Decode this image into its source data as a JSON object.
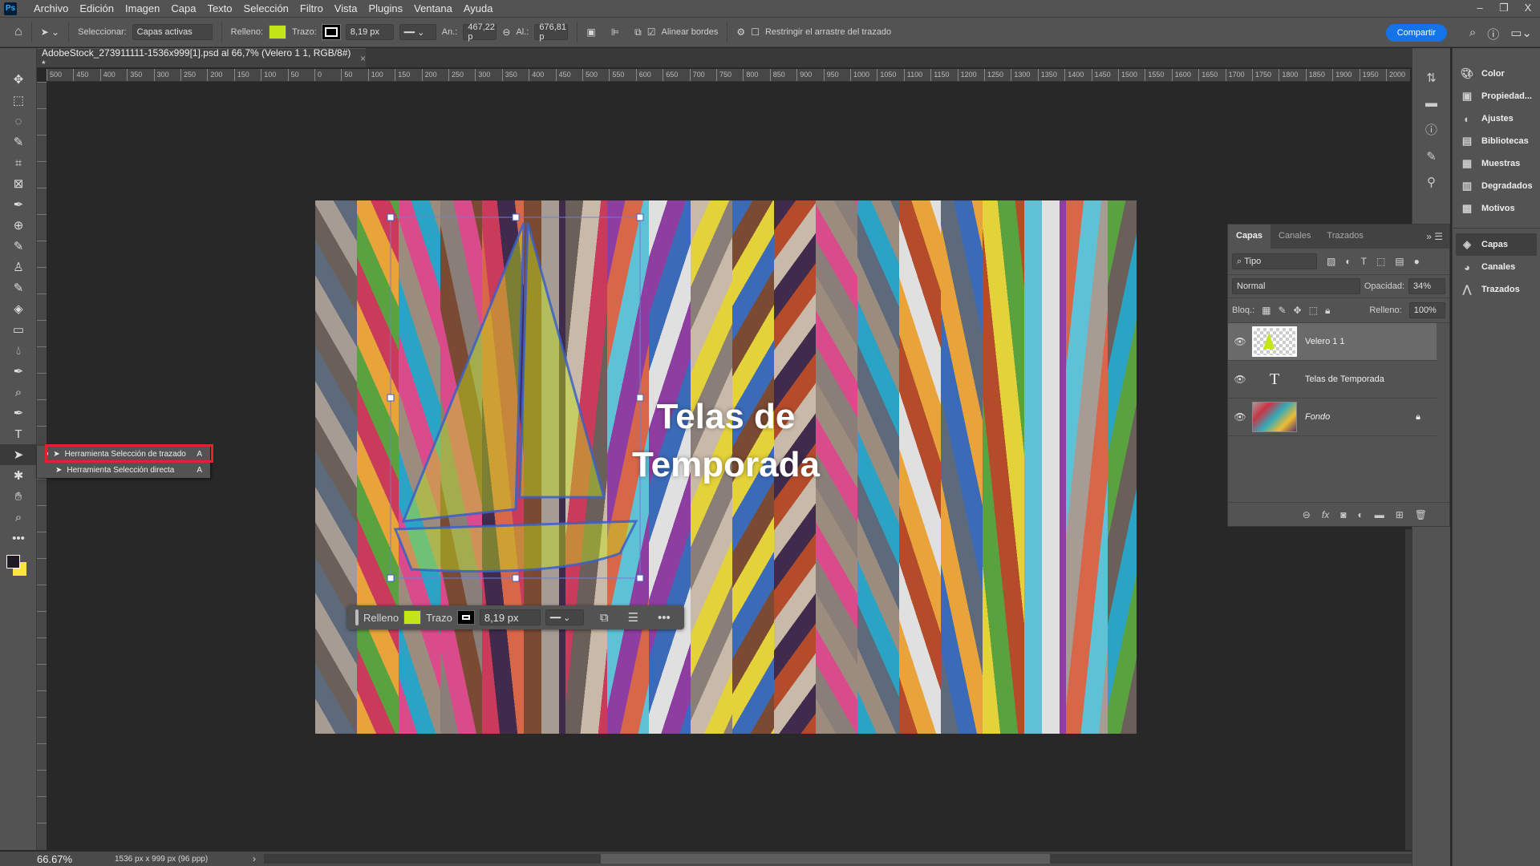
{
  "app": {
    "logo": "Ps"
  },
  "menu": [
    "Archivo",
    "Edición",
    "Imagen",
    "Capa",
    "Texto",
    "Selección",
    "Filtro",
    "Vista",
    "Plugins",
    "Ventana",
    "Ayuda"
  ],
  "window_controls": {
    "minimize": "–",
    "restore": "❐",
    "close": "X"
  },
  "options": {
    "select_label": "Seleccionar:",
    "select_value": "Capas activas",
    "fill_label": "Relleno:",
    "fill_color": "#c4e619",
    "stroke_label": "Trazo:",
    "stroke_width": "8,19 px",
    "width_label": "An.:",
    "width_value": "467,22 p",
    "height_label": "Al.:",
    "height_value": "676,81 p",
    "align_edges": "Alinear bordes",
    "restrict_drag": "Restringir el arrastre del trazado",
    "share": "Compartir"
  },
  "document": {
    "tab_title": "AdobeStock_273911111-1536x999[1].psd al 66,7% (Velero 1 1, RGB/8#) *",
    "canvas_title": [
      "Telas de",
      "Temporada"
    ]
  },
  "rulers": {
    "h": [
      500,
      450,
      400,
      350,
      300,
      250,
      200,
      150,
      100,
      50,
      0,
      50,
      100,
      150,
      200,
      250,
      300,
      350,
      400,
      450,
      500,
      550,
      600,
      650,
      700,
      750,
      800,
      850,
      900,
      950,
      1000,
      1050,
      1100,
      1150,
      1200,
      1250,
      1300,
      1350,
      1400,
      1450,
      1500,
      1550,
      1600,
      1650,
      1700,
      1750,
      1800,
      1850,
      1900,
      1950,
      2000
    ]
  },
  "flyout": {
    "items": [
      {
        "label": "Herramienta Selección de trazado",
        "key": "A",
        "selected": true
      },
      {
        "label": "Herramienta Selección directa",
        "key": "A"
      }
    ]
  },
  "context_bar": {
    "fill_label": "Relleno",
    "stroke_label": "Trazo",
    "stroke_width": "8,19 px"
  },
  "status": {
    "zoom": "66.67%",
    "doc_info": "1536 px x 999 px (96 ppp)"
  },
  "right_panels": [
    "Color",
    "Propiedad...",
    "Ajustes",
    "Bibliotecas",
    "Muestras",
    "Degradados",
    "Motivos"
  ],
  "right_panels2": [
    "Capas",
    "Canales",
    "Trazados"
  ],
  "layers_panel": {
    "tabs": [
      "Capas",
      "Canales",
      "Trazados"
    ],
    "filter": "Tipo",
    "blend": "Normal",
    "opacity_label": "Opacidad:",
    "opacity": "34%",
    "lock_label": "Bloq.:",
    "fill_label": "Relleno:",
    "fill": "100%",
    "layers": [
      {
        "name": "Velero 1 1",
        "selected": true
      },
      {
        "name": "Telas de Temporada",
        "type": "text"
      },
      {
        "name": "Fondo",
        "locked": true
      }
    ]
  },
  "colors": {
    "accent": "#1473e6",
    "fill": "#c4e619",
    "path": "#3b5fc8",
    "highlight": "#e0232e"
  }
}
